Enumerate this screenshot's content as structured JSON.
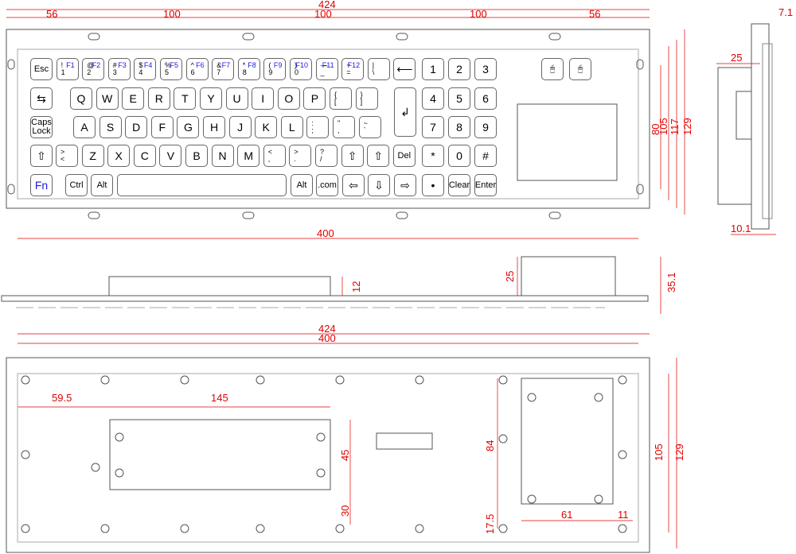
{
  "colors": {
    "dimension": "#e00000",
    "fn_label": "#1a1ae6",
    "outline": "#555555"
  },
  "keys": {
    "row1": [
      {
        "l": "Esc"
      },
      {
        "t": "!",
        "b": "1",
        "f": "F1"
      },
      {
        "t": "@",
        "b": "2",
        "f": "F2"
      },
      {
        "t": "#",
        "b": "3",
        "f": "F3"
      },
      {
        "t": "$",
        "b": "4",
        "f": "F4"
      },
      {
        "t": "%",
        "b": "5",
        "f": "F5"
      },
      {
        "t": "^",
        "b": "6",
        "f": "F6"
      },
      {
        "t": "&",
        "b": "7",
        "f": "F7"
      },
      {
        "t": "*",
        "b": "8",
        "f": "F8"
      },
      {
        "t": "(",
        "b": "9",
        "f": "F9"
      },
      {
        "t": ")",
        "b": "0",
        "f": "F10"
      },
      {
        "t": "—",
        "b": "_",
        "f": "F11"
      },
      {
        "t": "+",
        "b": "=",
        "f": "F12"
      },
      {
        "t": "|",
        "b": "\\"
      },
      {
        "l": "⟵"
      },
      {
        "l": "1"
      },
      {
        "l": "2"
      },
      {
        "l": "3"
      }
    ],
    "row2": [
      {
        "l": "⇆"
      },
      {
        "l": "Q"
      },
      {
        "l": "W"
      },
      {
        "l": "E"
      },
      {
        "l": "R"
      },
      {
        "l": "T"
      },
      {
        "l": "Y"
      },
      {
        "l": "U"
      },
      {
        "l": "I"
      },
      {
        "l": "O"
      },
      {
        "l": "P"
      },
      {
        "t": "{",
        "b": "["
      },
      {
        "t": "}",
        "b": "]"
      },
      {
        "l": "↲"
      },
      {
        "l": "4"
      },
      {
        "l": "5"
      },
      {
        "l": "6"
      }
    ],
    "row3": [
      {
        "l": "Caps Lock"
      },
      {
        "l": "A"
      },
      {
        "l": "S"
      },
      {
        "l": "D"
      },
      {
        "l": "F"
      },
      {
        "l": "G"
      },
      {
        "l": "H"
      },
      {
        "l": "J"
      },
      {
        "l": "K"
      },
      {
        "l": "L"
      },
      {
        "t": ":",
        "b": ";"
      },
      {
        "t": "\"",
        "b": ","
      },
      {
        "t": "~",
        "b": "`"
      },
      {
        "l": "7"
      },
      {
        "l": "8"
      },
      {
        "l": "9"
      }
    ],
    "row4": [
      {
        "l": "⇧"
      },
      {
        "t": ">",
        "b": "<"
      },
      {
        "l": "Z"
      },
      {
        "l": "X"
      },
      {
        "l": "C"
      },
      {
        "l": "V"
      },
      {
        "l": "B"
      },
      {
        "l": "N"
      },
      {
        "l": "M"
      },
      {
        "t": "<",
        "b": ","
      },
      {
        "t": ">",
        "b": "."
      },
      {
        "t": "?",
        "b": "/"
      },
      {
        "l": "⇧"
      },
      {
        "l": "⇧"
      },
      {
        "l": "Del"
      },
      {
        "l": "*"
      },
      {
        "l": "0"
      },
      {
        "l": "#"
      }
    ],
    "row5": [
      {
        "l": "Fn"
      },
      {
        "l": "Ctrl"
      },
      {
        "l": "Alt"
      },
      {
        "l": ""
      },
      {
        "l": "Alt"
      },
      {
        "l": ".com"
      },
      {
        "l": "⇦"
      },
      {
        "l": "⇩"
      },
      {
        "l": "⇨"
      },
      {
        "l": "•"
      },
      {
        "l": "Clear"
      },
      {
        "l": "Enter"
      }
    ],
    "mouse": [
      {
        "l": "left-click"
      },
      {
        "l": "right-click"
      }
    ]
  },
  "dimensions": {
    "top": {
      "overall_width": "424",
      "hole_edge_left": "56",
      "hole_pitch_1": "100",
      "hole_pitch_2": "100",
      "hole_pitch_3": "100",
      "hole_edge_right": "56",
      "inner_width": "400",
      "h80": "80",
      "h105": "105",
      "h117": "117",
      "h129": "129"
    },
    "side": {
      "depth": "25",
      "thickness_top": "7.1",
      "thickness_bottom": "10.1"
    },
    "front": {
      "h12": "12",
      "h25": "25",
      "total": "35.1"
    },
    "rear": {
      "overall_width": "424",
      "inner_width": "400",
      "offset": "59.5",
      "box_width": "145",
      "box_height": "45",
      "box_bottom": "30",
      "pad_height": "84",
      "pad_bottom": "17.5",
      "pad_width": "61",
      "pad_right": "11",
      "h105": "105",
      "h129": "129"
    }
  }
}
